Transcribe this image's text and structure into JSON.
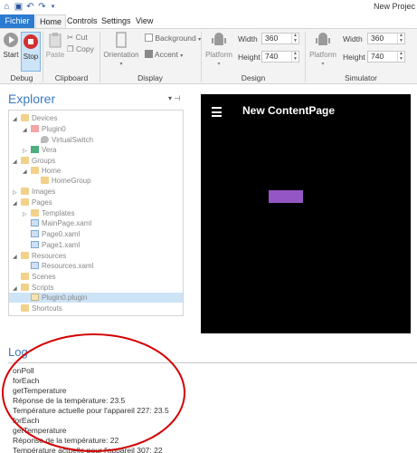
{
  "window": {
    "title": "New Projec"
  },
  "quick_access": {
    "icons": [
      "app-icon",
      "save-icon",
      "undo-icon",
      "redo-icon",
      "dropdown-icon"
    ]
  },
  "menu": {
    "file": "Fichier",
    "tabs": [
      "Home",
      "Controls",
      "Settings",
      "View"
    ]
  },
  "ribbon": {
    "debug": {
      "label": "Debug",
      "start": "Start",
      "stop": "Stop"
    },
    "clipboard": {
      "label": "Clipboard",
      "paste": "Paste",
      "cut": "Cut",
      "copy": "Copy"
    },
    "display": {
      "label": "Display",
      "orientation": "Orientation",
      "background": "Background",
      "accent": "Accent"
    },
    "design": {
      "label": "Design",
      "platform": "Platform",
      "width_label": "Width",
      "width_value": "360",
      "height_label": "Height",
      "height_value": "740"
    },
    "simulator": {
      "label": "Simulator",
      "platform": "Platform",
      "width_label": "Width",
      "width_value": "360",
      "height_label": "Height",
      "height_value": "740"
    }
  },
  "explorer": {
    "title": "Explorer",
    "items": [
      {
        "label": "Devices"
      },
      {
        "label": "Plugin0"
      },
      {
        "label": "VirtualSwitch"
      },
      {
        "label": "Vera"
      },
      {
        "label": "Groups"
      },
      {
        "label": "Home"
      },
      {
        "label": "HomeGroup"
      },
      {
        "label": "Images"
      },
      {
        "label": "Pages"
      },
      {
        "label": "Templates"
      },
      {
        "label": "MainPage.xaml"
      },
      {
        "label": "Page0.xaml"
      },
      {
        "label": "Page1.xaml"
      },
      {
        "label": "Resources"
      },
      {
        "label": "Resources.xaml"
      },
      {
        "label": "Scenes"
      },
      {
        "label": "Scripts"
      },
      {
        "label": "Plugin0.plugin"
      },
      {
        "label": "Shortcuts"
      }
    ]
  },
  "preview": {
    "page_title": "New ContentPage",
    "box_color": "#9456c4"
  },
  "log": {
    "title": "Log",
    "lines": [
      "onPoll",
      "forEach",
      "getTemperature",
      "Réponse de la température: 23.5",
      "Température actuelle pour l'appareil 227: 23.5",
      "forEach",
      "getTemperature",
      "Réponse de la température: 22",
      "Température actuelle pour l'appareil 307: 22"
    ]
  },
  "colors": {
    "accent": "#2b7bd0",
    "annotation": "#d40000"
  }
}
